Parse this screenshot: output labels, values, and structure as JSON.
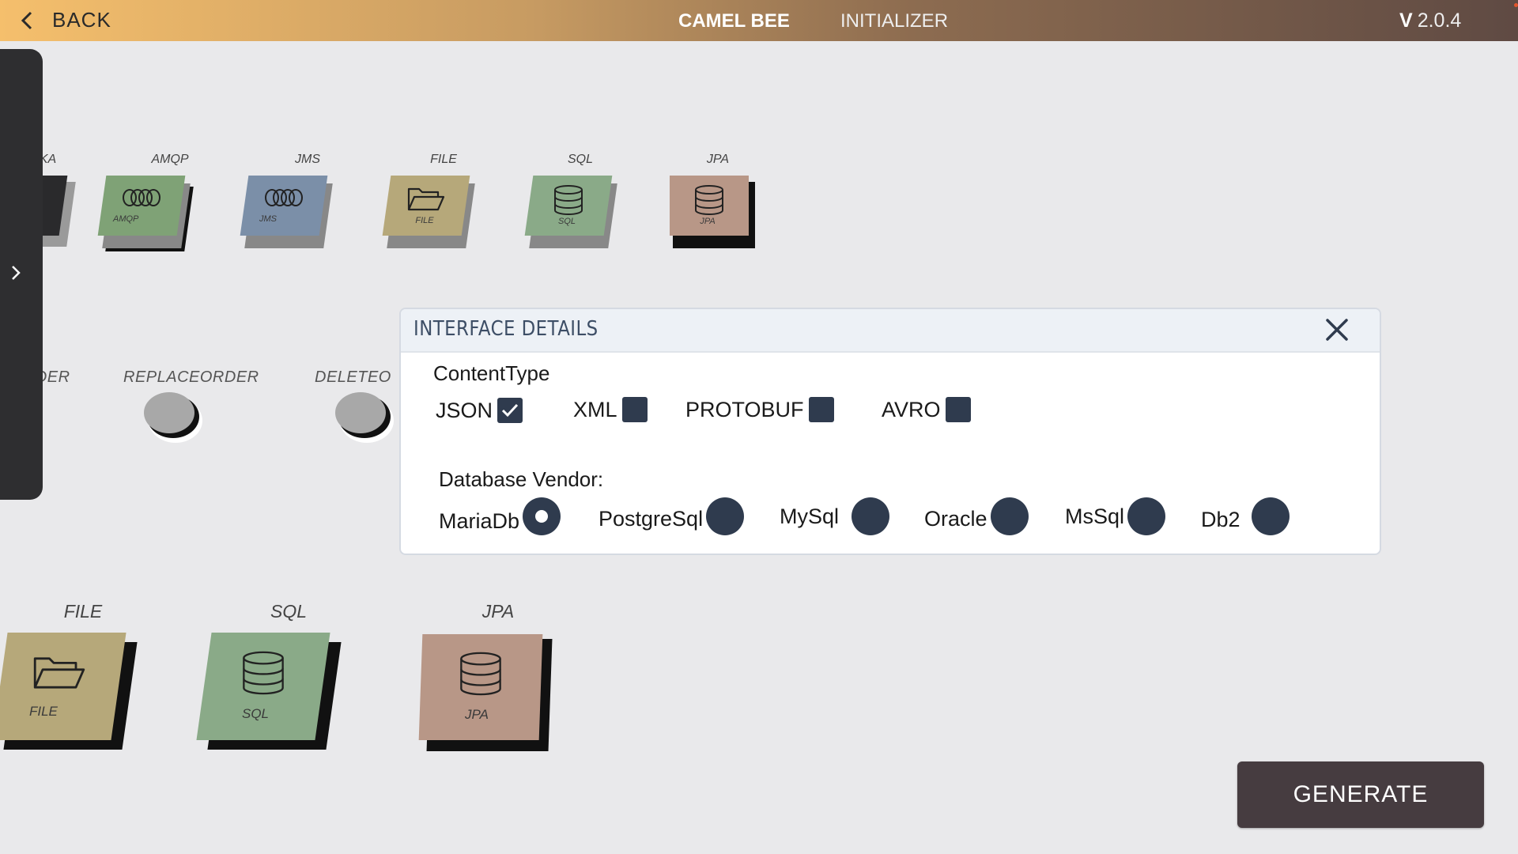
{
  "topbar": {
    "back_label": "BACK",
    "app_title": "CAMEL BEE",
    "app_subtitle": "INITIALIZER",
    "version_prefix": "V",
    "version": "2.0.4"
  },
  "colors": {
    "amqp": "#7fa276",
    "jms": "#7b8fa8",
    "file": "#b6a87a",
    "sql": "#8aaa88",
    "jpa": "#b89787",
    "kafka": "#2a2a2c",
    "dialog_accent": "#2f3b4e",
    "generate": "#463c40"
  },
  "top_tiles": [
    {
      "label": "KAFKA",
      "caption": "",
      "icon": "kafka-icon"
    },
    {
      "label": "AMQP",
      "caption": "AMQP",
      "icon": "amqp-icon"
    },
    {
      "label": "JMS",
      "caption": "JMS",
      "icon": "jms-icon"
    },
    {
      "label": "FILE",
      "caption": "FILE",
      "icon": "folder-icon"
    },
    {
      "label": "SQL",
      "caption": "SQL",
      "icon": "database-icon"
    },
    {
      "label": "JPA",
      "caption": "JPA",
      "icon": "database-icon"
    }
  ],
  "operations": [
    {
      "label": "EORDER"
    },
    {
      "label": "REPLACEORDER"
    },
    {
      "label": "DELETEO"
    }
  ],
  "bottom_tiles": [
    {
      "label": "FILE",
      "caption": "FILE",
      "icon": "folder-icon"
    },
    {
      "label": "SQL",
      "caption": "SQL",
      "icon": "database-icon"
    },
    {
      "label": "JPA",
      "caption": "JPA",
      "icon": "database-icon"
    }
  ],
  "dialog": {
    "title": "INTERFACE DETAILS",
    "content_type_label": "ContentType",
    "content_types": [
      {
        "label": "JSON",
        "checked": true
      },
      {
        "label": "XML",
        "checked": false
      },
      {
        "label": "PROTOBUF",
        "checked": false
      },
      {
        "label": "AVRO",
        "checked": false
      }
    ],
    "vendor_label": "Database Vendor:",
    "vendors": [
      {
        "label": "MariaDb",
        "selected": true
      },
      {
        "label": "PostgreSql",
        "selected": false
      },
      {
        "label": "MySql",
        "selected": false
      },
      {
        "label": "Oracle",
        "selected": false
      },
      {
        "label": "MsSql",
        "selected": false
      },
      {
        "label": "Db2",
        "selected": false
      }
    ]
  },
  "generate_label": "GENERATE"
}
